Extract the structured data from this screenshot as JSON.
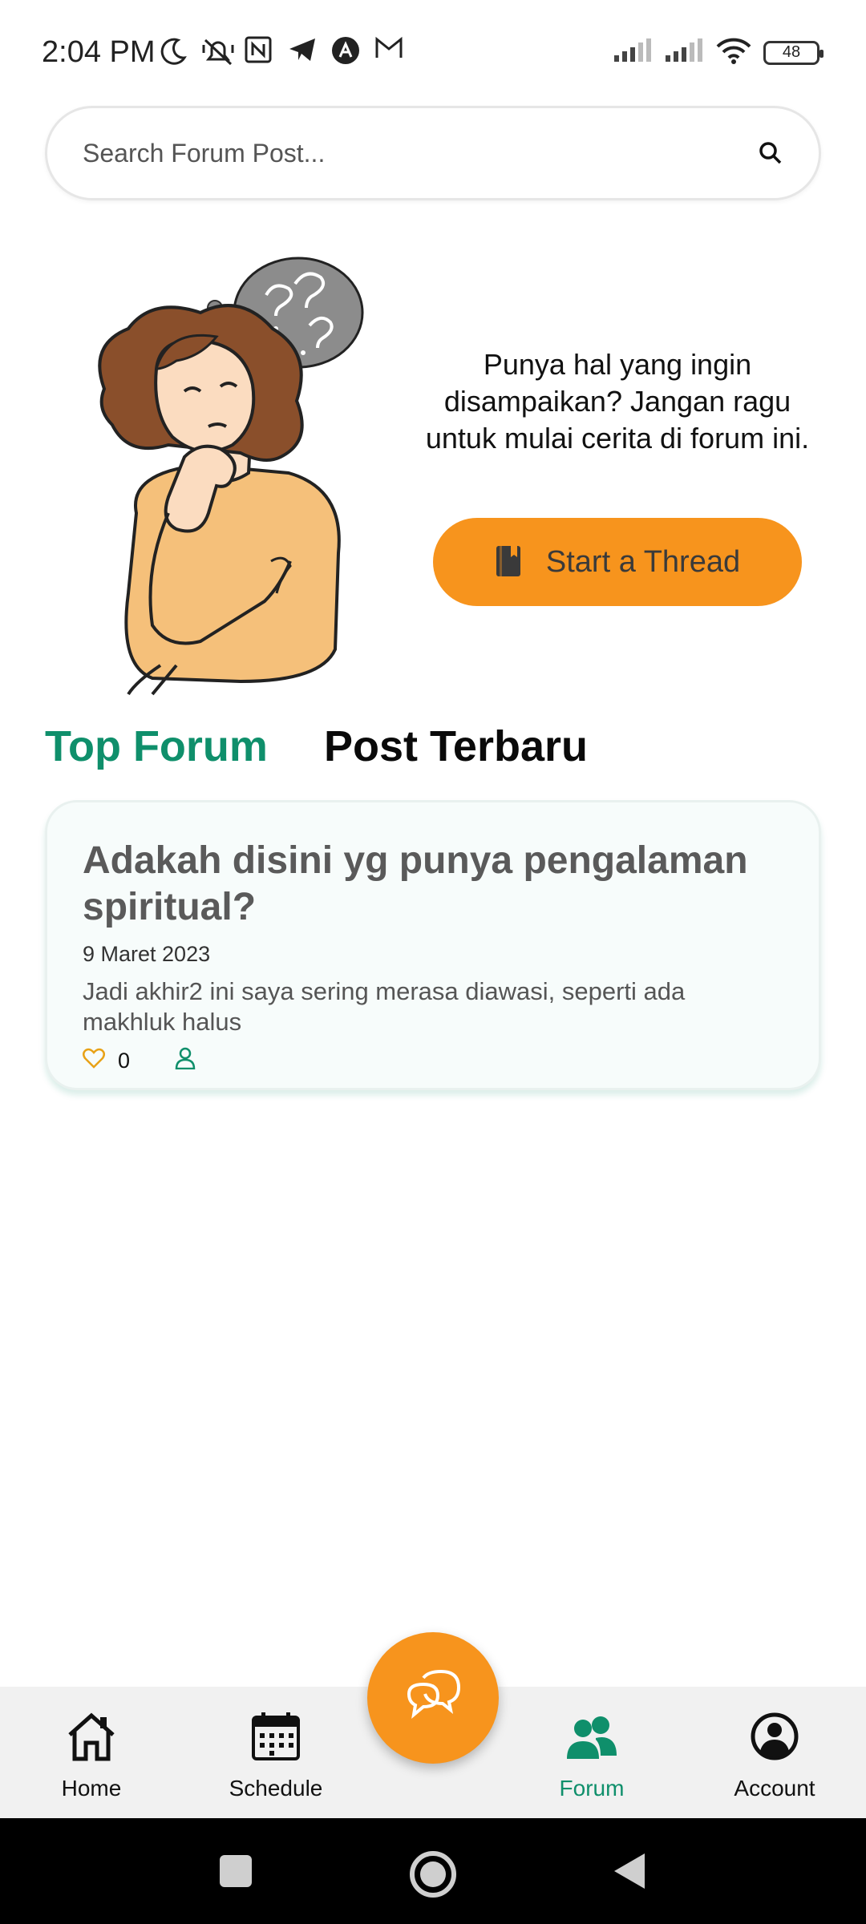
{
  "status_bar": {
    "time": "2:04 PM",
    "battery": "48",
    "left_icons": [
      "moon-icon",
      "bell-off-icon",
      "nfc-icon",
      "telegram-icon",
      "app-icon",
      "gmail-icon"
    ],
    "right_icons": [
      "signal-icon",
      "signal-icon",
      "wifi-icon",
      "battery-icon"
    ]
  },
  "search": {
    "placeholder": "Search Forum Post..."
  },
  "hero": {
    "text": "Punya hal yang ingin disampaikan? Jangan ragu untuk mulai cerita di forum ini.",
    "button_label": "Start a Thread",
    "button_icon": "book-icon"
  },
  "tabs": [
    {
      "label": "Top Forum",
      "active": true
    },
    {
      "label": "Post Terbaru",
      "active": false
    }
  ],
  "posts": [
    {
      "title": "Adakah disini yg punya pengalaman spiritual?",
      "date": "9 Maret 2023",
      "excerpt": "Jadi akhir2 ini saya sering merasa diawasi, seperti ada makhluk halus",
      "likes": "0"
    }
  ],
  "bottom_nav": {
    "items": [
      {
        "label": "Home",
        "icon": "home-icon"
      },
      {
        "label": "Schedule",
        "icon": "calendar-icon"
      },
      {
        "label": "Forum",
        "icon": "users-icon",
        "active": true
      },
      {
        "label": "Account",
        "icon": "account-icon"
      }
    ],
    "fab_icon": "chat-icon"
  },
  "colors": {
    "accent_orange": "#f7941d",
    "accent_green": "#0f8f6b"
  }
}
